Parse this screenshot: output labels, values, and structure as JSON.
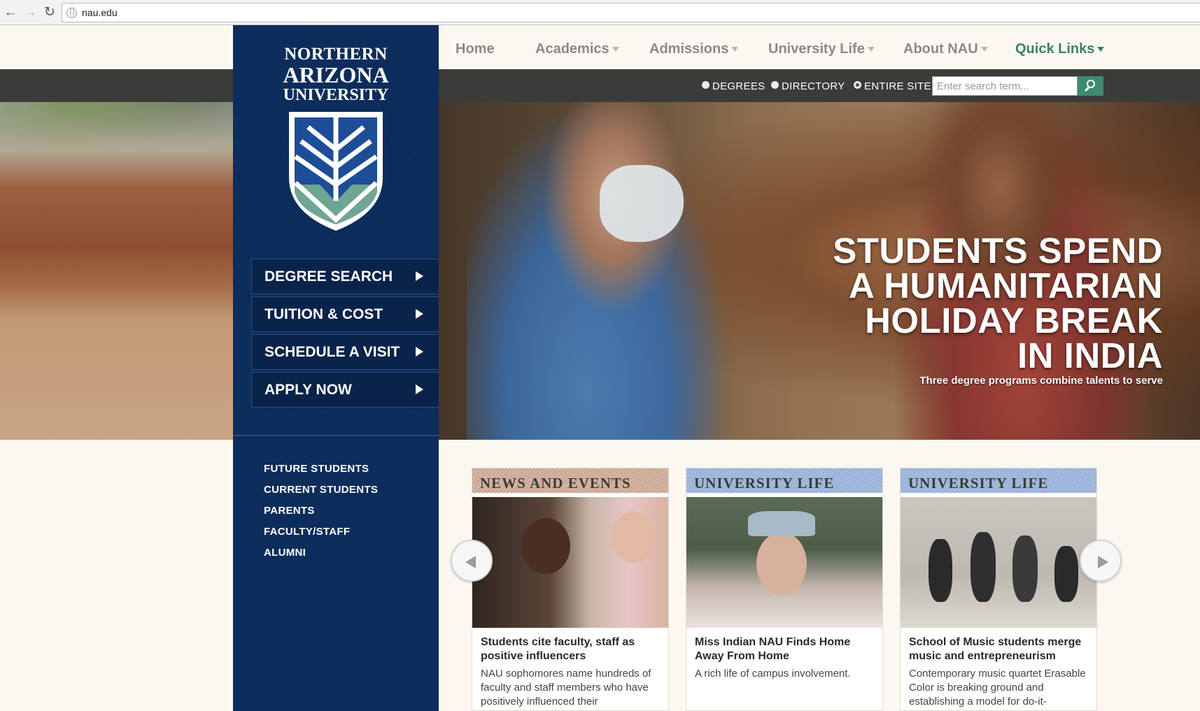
{
  "browser": {
    "url": "nau.edu",
    "back_glyph": "←",
    "forward_glyph": "→",
    "reload_glyph": "↻"
  },
  "logo": {
    "line1": "NORTHERN",
    "line2": "ARIZONA",
    "line3": "UNIVERSITY",
    "shield_icon": "nau-shield-icon"
  },
  "quick_buttons": [
    {
      "label": "DEGREE SEARCH"
    },
    {
      "label": "TUITION & COST"
    },
    {
      "label": "SCHEDULE A VISIT"
    },
    {
      "label": "APPLY NOW"
    }
  ],
  "audience_links": [
    "FUTURE STUDENTS",
    "CURRENT STUDENTS",
    "PARENTS",
    "FACULTY/STAFF",
    "ALUMNI"
  ],
  "top_nav": {
    "home": "Home",
    "academics": "Academics",
    "admissions": "Admissions",
    "university_life": "University Life",
    "about": "About NAU",
    "quick_links": "Quick Links"
  },
  "search": {
    "radio_degrees": "DEGREES",
    "radio_directory": "DIRECTORY",
    "radio_entire_site": "ENTIRE SITE",
    "selected": "ENTIRE SITE",
    "placeholder": "Enter search term..."
  },
  "hero": {
    "headline_lines": [
      "STUDENTS SPEND",
      "A HUMANITARIAN",
      "HOLIDAY BREAK",
      "IN INDIA"
    ],
    "subtitle": "Three degree programs combine talents to serve"
  },
  "cards": [
    {
      "header": "NEWS AND EVENTS",
      "title": "Students cite faculty, staff as positive influencers",
      "description": "NAU sophomores name hundreds of faculty and staff members who have positively influenced their"
    },
    {
      "header": "UNIVERSITY LIFE",
      "title": "Miss Indian NAU Finds Home Away From Home",
      "description": "A rich life of campus involvement."
    },
    {
      "header": "UNIVERSITY LIFE",
      "title": "School of Music students merge music and entrepreneurism",
      "description": "Contemporary music quartet Erasable Color is breaking ground and establishing a model for do-it-"
    }
  ],
  "colors": {
    "sidebar_navy": "#0b2a56",
    "accent_green": "#3f8a72",
    "search_bar_gray": "#3b3b3a",
    "page_bg": "#fbf8f2"
  }
}
